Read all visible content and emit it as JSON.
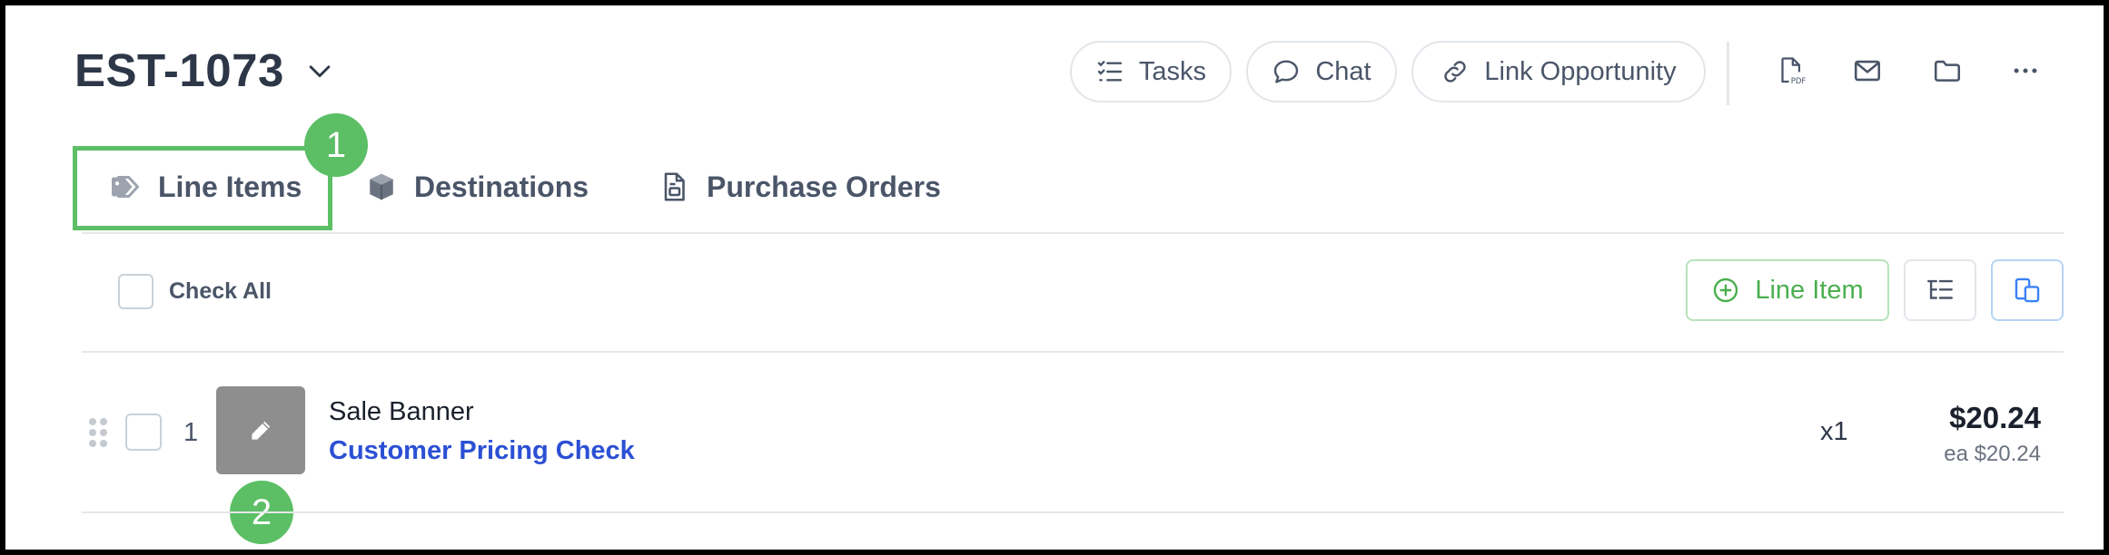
{
  "header": {
    "title": "EST-1073",
    "tasks_label": "Tasks",
    "chat_label": "Chat",
    "link_opportunity_label": "Link Opportunity",
    "pdf_icon_text": "PDF"
  },
  "tabs": [
    {
      "label": "Line Items",
      "icon": "tag-icon",
      "active": true
    },
    {
      "label": "Destinations",
      "icon": "box-icon"
    },
    {
      "label": "Purchase Orders",
      "icon": "document-icon"
    }
  ],
  "annotations": [
    "1",
    "2"
  ],
  "toolbar": {
    "check_all_label": "Check All",
    "line_item_button": "Line Item"
  },
  "items": [
    {
      "number": "1",
      "name": "Sale Banner",
      "link": "Customer Pricing Check",
      "quantity": "x1",
      "price": "$20.24",
      "unit_price": "ea $20.24"
    }
  ],
  "colors": {
    "accent_green": "#5cbf66",
    "link_blue": "#2b50d4",
    "frame": "#000000"
  }
}
